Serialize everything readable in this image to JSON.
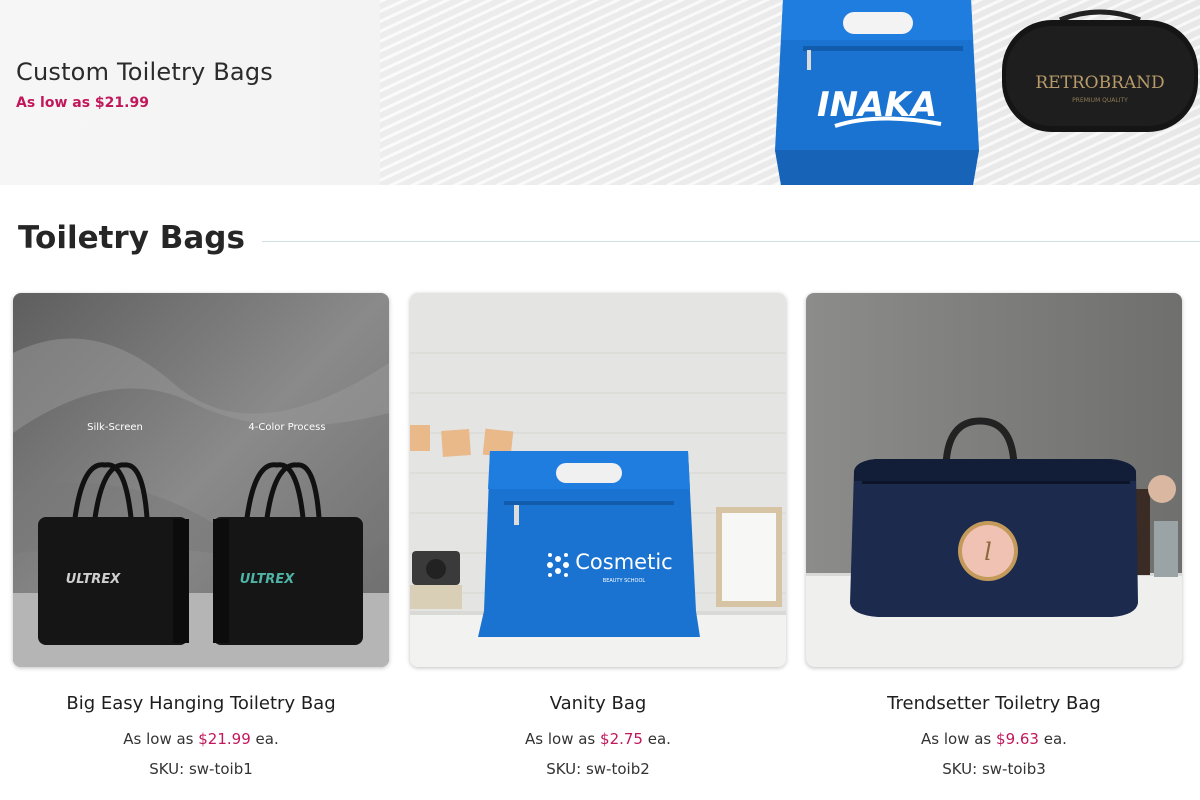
{
  "banner": {
    "title": "Custom Toiletry Bags",
    "price": "As low as $21.99",
    "bag1_brand": "INAKA",
    "bag2_brand": "RETROBRAND",
    "bag2_tagline": "PREMIUM QUALITY"
  },
  "section": {
    "title": "Toiletry Bags"
  },
  "colors": {
    "accent": "#c2185b",
    "bag_blue": "#1a73d1",
    "divider": "#cfe0e4"
  },
  "products": [
    {
      "name": "Big Easy Hanging Toiletry Bag",
      "price_prefix": "As low as",
      "price": "$21.99",
      "price_suffix": "ea.",
      "sku": "SKU: sw-toib1",
      "img_label_left": "Silk-Screen",
      "img_label_right": "4-Color Process",
      "img_brand": "ULTREX"
    },
    {
      "name": "Vanity Bag",
      "price_prefix": "As low as",
      "price": "$2.75",
      "price_suffix": "ea.",
      "sku": "SKU: sw-toib2",
      "img_brand": "Cosmetic",
      "img_sub": "BEAUTY SCHOOL"
    },
    {
      "name": "Trendsetter Toiletry Bag",
      "price_prefix": "As low as",
      "price": "$9.63",
      "price_suffix": "ea.",
      "sku": "SKU: sw-toib3",
      "img_brand": "l"
    }
  ]
}
